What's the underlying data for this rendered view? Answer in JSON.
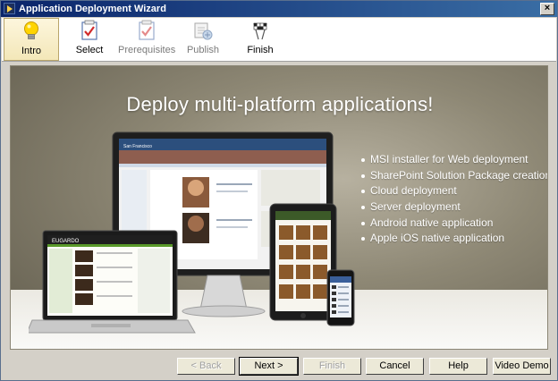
{
  "window": {
    "title": "Application Deployment Wizard",
    "close_label": "×"
  },
  "steps": [
    {
      "label": "Intro",
      "icon": "lightbulb-icon",
      "state": "active"
    },
    {
      "label": "Select",
      "icon": "checklist-icon",
      "state": "enabled"
    },
    {
      "label": "Prerequisites",
      "icon": "checklist-icon",
      "state": "disabled"
    },
    {
      "label": "Publish",
      "icon": "publish-icon",
      "state": "disabled"
    },
    {
      "label": "Finish",
      "icon": "checkered-flags-icon",
      "state": "enabled"
    }
  ],
  "intro": {
    "headline": "Deploy multi-platform applications!",
    "features": [
      "MSI installer for Web deployment",
      "SharePoint Solution Package creation",
      "Cloud deployment",
      "Server deployment",
      "Android native application",
      "Apple iOS native application"
    ],
    "laptop_brand": "EUGARDO",
    "monitor_header": "San Francisco"
  },
  "buttons": {
    "back": "< Back",
    "next": "Next >",
    "finish": "Finish",
    "cancel": "Cancel",
    "help": "Help",
    "video_demo": "Video Demo"
  },
  "colors": {
    "title_bar_start": "#0a246a",
    "title_bar_end": "#3a6ea5",
    "content_bg": "#8e8875",
    "active_step_bg": "#f3e7b8"
  }
}
